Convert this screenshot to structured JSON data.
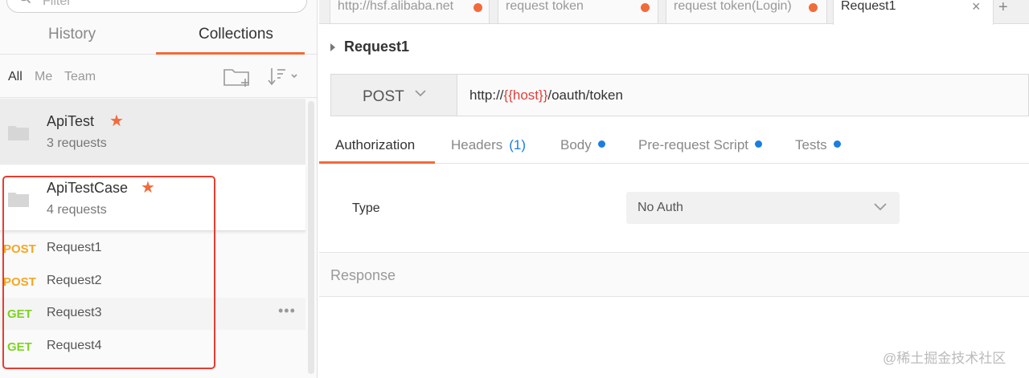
{
  "sidebar": {
    "filter_placeholder": "Filter",
    "tabs": {
      "history": "History",
      "collections": "Collections"
    },
    "filters": {
      "all": "All",
      "me": "Me",
      "team": "Team"
    },
    "collections": [
      {
        "name": "ApiTest",
        "count": "3 requests",
        "starred": "★"
      },
      {
        "name": "ApiTestCase",
        "count": "4 requests",
        "starred": "★"
      }
    ],
    "requests": [
      {
        "method": "POST",
        "name": "Request1"
      },
      {
        "method": "POST",
        "name": "Request2"
      },
      {
        "method": "GET",
        "name": "Request3"
      },
      {
        "method": "GET",
        "name": "Request4"
      }
    ],
    "more_label": "•••"
  },
  "main": {
    "tabs": [
      {
        "label": "http://hsf.alibaba.net"
      },
      {
        "label": "request token"
      },
      {
        "label": "request token(Login)"
      },
      {
        "label": "Request1",
        "close": "×"
      }
    ],
    "plus_label": "+",
    "request_title": "Request1",
    "method": "POST",
    "url_prefix": "http://",
    "url_var": "{{host}}",
    "url_suffix": "/oauth/token",
    "request_tabs": {
      "authorization": "Authorization",
      "headers": "Headers",
      "headers_count": "(1)",
      "body": "Body",
      "prescript": "Pre-request Script",
      "tests": "Tests"
    },
    "auth": {
      "type_label": "Type",
      "type_value": "No Auth"
    },
    "response_label": "Response"
  },
  "watermark": "@稀土掘金技术社区",
  "colors": {
    "accent": "#f26b3a",
    "post": "#f5a623",
    "get": "#7ed321",
    "link": "#1a7ee0",
    "highlight_box": "#e63c2f"
  }
}
